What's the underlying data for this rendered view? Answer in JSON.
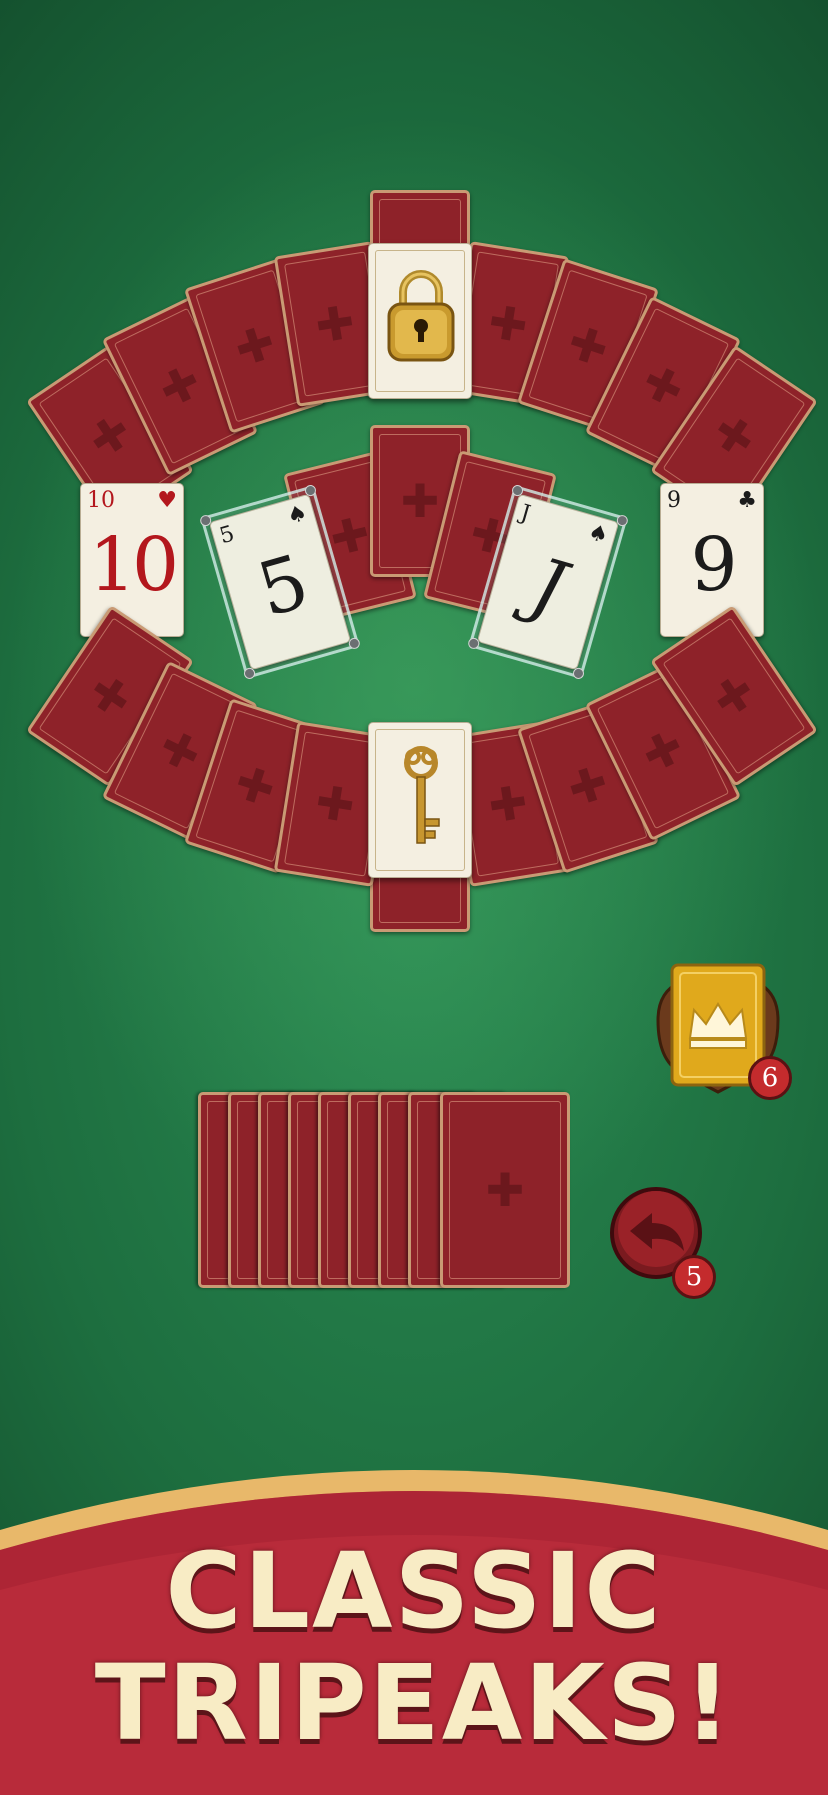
{
  "game": {
    "name": "Classic TriPeaks",
    "tableau_face_up": [
      {
        "rank": "10",
        "suit": "♥",
        "color": "red",
        "state": "open"
      },
      {
        "rank": "5",
        "suit": "♠",
        "color": "black",
        "state": "glass-locked"
      },
      {
        "rank": "J",
        "suit": "♠",
        "color": "black",
        "state": "glass-locked"
      },
      {
        "rank": "9",
        "suit": "♣",
        "color": "black",
        "state": "open"
      }
    ],
    "special_cards": [
      {
        "type": "padlock",
        "icon": "padlock-icon"
      },
      {
        "type": "key",
        "icon": "key-icon"
      }
    ],
    "stock_pile_visible_cards": 9,
    "colors": {
      "felt": "#1f6a3f",
      "card_back": "#8e2229",
      "card_face": "#f4efe1",
      "banner": "#b82b3a",
      "banner_trim": "#e8b86a",
      "title_text": "#f8ecc5"
    }
  },
  "powerups": {
    "king_wild": {
      "icon": "crown-card-icon",
      "count": "6"
    },
    "undo": {
      "icon": "undo-arrow-icon",
      "count": "5"
    }
  },
  "banner": {
    "line1": "CLASSIC",
    "line2": "TRIPEAKS!"
  }
}
